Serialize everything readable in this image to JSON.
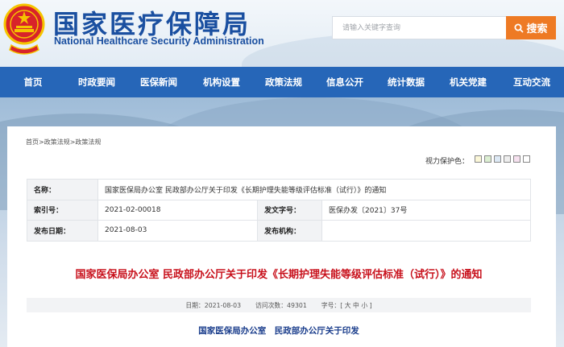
{
  "header": {
    "title": "国家医疗保障局",
    "subtitle": "National Healthcare Security Administration",
    "search_placeholder": "请输入关键字查询",
    "search_button": "搜索"
  },
  "nav": {
    "items": [
      "首页",
      "时政要闻",
      "医保新闻",
      "机构设置",
      "政策法规",
      "信息公开",
      "统计数据",
      "机关党建",
      "互动交流"
    ]
  },
  "breadcrumb": {
    "home": "首页",
    "sep1": ">",
    "section": "政策法规",
    "sep2": ">",
    "current": "政策法规"
  },
  "eye_protection": {
    "label": "视力保护色：",
    "colors": [
      "#fbf7d8",
      "#dcefd2",
      "#dde9f5",
      "#eeeeee",
      "#f6e1ef",
      "#ffffff"
    ]
  },
  "info": {
    "name_label": "名称：",
    "name_value": "国家医保局办公室 民政部办公厅关于印发《长期护理失能等级评估标准（试行）》的通知",
    "index_label": "索引号：",
    "index_value": "2021-02-00018",
    "doc_no_label": "发文字号：",
    "doc_no_value": "医保办发〔2021〕37号",
    "date_label": "发布日期：",
    "date_value": "2021-08-03",
    "org_label": "发布机构：",
    "org_value": ""
  },
  "article": {
    "title": "国家医保局办公室 民政部办公厅关于印发《长期护理失能等级评估标准（试行）》的通知",
    "meta_date": "日期：2021-08-03",
    "meta_visits": "访问次数：49301",
    "meta_font_label": "字号：[",
    "meta_font_large": "大",
    "meta_font_medium": "中",
    "meta_font_small": "小",
    "meta_font_close": "]",
    "issuers": "国家医保局办公室　民政部办公厅关于印发"
  },
  "colors": {
    "brand_blue": "#1a4fa0",
    "nav_blue": "#2666b8",
    "search_orange": "#ee7a24",
    "title_red": "#c8111c"
  },
  "icons": {
    "emblem": "national-emblem-icon",
    "search": "search-icon"
  }
}
